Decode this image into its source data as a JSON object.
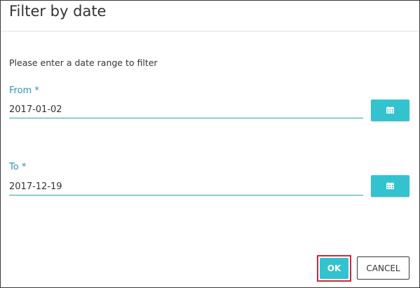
{
  "dialog": {
    "title": "Filter by date",
    "instructions": "Please enter a date range to filter"
  },
  "from": {
    "label": "From *",
    "value": "2017-01-02",
    "calendar_icon": "calendar-icon"
  },
  "to": {
    "label": "To *",
    "value": "2017-12-19",
    "calendar_icon": "calendar-icon"
  },
  "actions": {
    "ok_label": "OK",
    "cancel_label": "CANCEL"
  },
  "colors": {
    "accent": "#32c3cf",
    "label": "#2a93b3",
    "underline": "#2aa9a2",
    "highlight": "#d0263b"
  }
}
